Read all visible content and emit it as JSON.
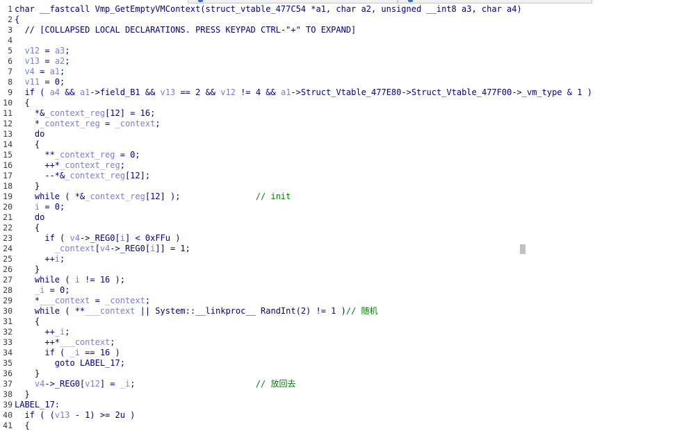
{
  "lines": [
    {
      "n": "1",
      "tokens": [
        {
          "t": "t",
          "s": "char __fastcall Vmp_GetEmptyVMContext(struct_vtable_477C54 *a1, char a2, unsigned __int8 a3, char a4)"
        }
      ]
    },
    {
      "n": "2",
      "tokens": [
        {
          "t": "t",
          "s": "{"
        }
      ]
    },
    {
      "n": "3",
      "tokens": [
        {
          "t": "t",
          "s": "  // [COLLAPSED LOCAL DECLARATIONS. PRESS KEYPAD CTRL-\"+\" TO EXPAND]"
        }
      ]
    },
    {
      "n": "4",
      "tokens": []
    },
    {
      "n": "5",
      "tokens": [
        {
          "t": "v",
          "s": "  v12"
        },
        {
          "t": "t",
          "s": " = "
        },
        {
          "t": "v",
          "s": "a3"
        },
        {
          "t": "t",
          "s": ";"
        }
      ]
    },
    {
      "n": "6",
      "tokens": [
        {
          "t": "v",
          "s": "  v13"
        },
        {
          "t": "t",
          "s": " = "
        },
        {
          "t": "v",
          "s": "a2"
        },
        {
          "t": "t",
          "s": ";"
        }
      ]
    },
    {
      "n": "7",
      "tokens": [
        {
          "t": "v",
          "s": "  v4"
        },
        {
          "t": "t",
          "s": " = "
        },
        {
          "t": "v",
          "s": "a1"
        },
        {
          "t": "t",
          "s": ";"
        }
      ]
    },
    {
      "n": "8",
      "tokens": [
        {
          "t": "v",
          "s": "  v11"
        },
        {
          "t": "t",
          "s": " = 0;"
        }
      ]
    },
    {
      "n": "9",
      "tokens": [
        {
          "t": "t",
          "s": "  if ( "
        },
        {
          "t": "v",
          "s": "a4"
        },
        {
          "t": "t",
          "s": " && "
        },
        {
          "t": "v",
          "s": "a1"
        },
        {
          "t": "t",
          "s": "->field_B1 && "
        },
        {
          "t": "v",
          "s": "v13"
        },
        {
          "t": "t",
          "s": " == 2 && "
        },
        {
          "t": "v",
          "s": "v12"
        },
        {
          "t": "t",
          "s": " != 4 && "
        },
        {
          "t": "v",
          "s": "a1"
        },
        {
          "t": "t",
          "s": "->Struct_Vtable_477E80->Struct_Vtable_477F00->_vm_type & 1 )"
        }
      ]
    },
    {
      "n": "10",
      "tokens": [
        {
          "t": "t",
          "s": "  {"
        }
      ]
    },
    {
      "n": "11",
      "tokens": [
        {
          "t": "t",
          "s": "    *&"
        },
        {
          "t": "v",
          "s": "_context_reg"
        },
        {
          "t": "t",
          "s": "[12] = 16;"
        }
      ]
    },
    {
      "n": "12",
      "tokens": [
        {
          "t": "t",
          "s": "    *"
        },
        {
          "t": "v",
          "s": "_context_reg"
        },
        {
          "t": "t",
          "s": " = "
        },
        {
          "t": "v",
          "s": "_context"
        },
        {
          "t": "t",
          "s": ";"
        }
      ]
    },
    {
      "n": "13",
      "tokens": [
        {
          "t": "t",
          "s": "    do"
        }
      ]
    },
    {
      "n": "14",
      "tokens": [
        {
          "t": "t",
          "s": "    {"
        }
      ]
    },
    {
      "n": "15",
      "tokens": [
        {
          "t": "t",
          "s": "      **"
        },
        {
          "t": "v",
          "s": "_context_reg"
        },
        {
          "t": "t",
          "s": " = 0;"
        }
      ]
    },
    {
      "n": "16",
      "tokens": [
        {
          "t": "t",
          "s": "      ++*"
        },
        {
          "t": "v",
          "s": "_context_reg"
        },
        {
          "t": "t",
          "s": ";"
        }
      ]
    },
    {
      "n": "17",
      "tokens": [
        {
          "t": "t",
          "s": "      --*&"
        },
        {
          "t": "v",
          "s": "_context_reg"
        },
        {
          "t": "t",
          "s": "[12];"
        }
      ]
    },
    {
      "n": "18",
      "tokens": [
        {
          "t": "t",
          "s": "    }"
        }
      ]
    },
    {
      "n": "19",
      "tokens": [
        {
          "t": "t",
          "s": "    while ( *&"
        },
        {
          "t": "v",
          "s": "_context_reg"
        },
        {
          "t": "t",
          "s": "[12] );               "
        },
        {
          "t": "c",
          "s": "// init"
        }
      ]
    },
    {
      "n": "20",
      "tokens": [
        {
          "t": "v",
          "s": "    i"
        },
        {
          "t": "t",
          "s": " = 0;"
        }
      ]
    },
    {
      "n": "21",
      "tokens": [
        {
          "t": "t",
          "s": "    do"
        }
      ]
    },
    {
      "n": "22",
      "tokens": [
        {
          "t": "t",
          "s": "    {"
        }
      ]
    },
    {
      "n": "23",
      "tokens": [
        {
          "t": "t",
          "s": "      if ( "
        },
        {
          "t": "v",
          "s": "v4"
        },
        {
          "t": "t",
          "s": "->_REG0["
        },
        {
          "t": "v",
          "s": "i"
        },
        {
          "t": "t",
          "s": "] < 0xFFu )"
        }
      ]
    },
    {
      "n": "24",
      "tokens": [
        {
          "t": "v",
          "s": "        _context"
        },
        {
          "t": "t",
          "s": "["
        },
        {
          "t": "v",
          "s": "v4"
        },
        {
          "t": "t",
          "s": "->_REG0["
        },
        {
          "t": "v",
          "s": "i"
        },
        {
          "t": "t",
          "s": "]] = 1;"
        }
      ]
    },
    {
      "n": "25",
      "tokens": [
        {
          "t": "t",
          "s": "      ++"
        },
        {
          "t": "v",
          "s": "i"
        },
        {
          "t": "t",
          "s": ";"
        }
      ]
    },
    {
      "n": "26",
      "tokens": [
        {
          "t": "t",
          "s": "    }"
        }
      ]
    },
    {
      "n": "27",
      "tokens": [
        {
          "t": "t",
          "s": "    while ( "
        },
        {
          "t": "v",
          "s": "i"
        },
        {
          "t": "t",
          "s": " != 16 );"
        }
      ]
    },
    {
      "n": "28",
      "tokens": [
        {
          "t": "v",
          "s": "    _i"
        },
        {
          "t": "t",
          "s": " = 0;"
        }
      ]
    },
    {
      "n": "29",
      "tokens": [
        {
          "t": "t",
          "s": "    *"
        },
        {
          "t": "v",
          "s": "___context"
        },
        {
          "t": "t",
          "s": " = "
        },
        {
          "t": "v",
          "s": "_context"
        },
        {
          "t": "t",
          "s": ";"
        }
      ]
    },
    {
      "n": "30",
      "tokens": [
        {
          "t": "t",
          "s": "    while ( **"
        },
        {
          "t": "v",
          "s": "___context"
        },
        {
          "t": "t",
          "s": " || System::__linkproc__ RandInt(2) != 1 )"
        },
        {
          "t": "c",
          "s": "// 随机"
        }
      ]
    },
    {
      "n": "31",
      "tokens": [
        {
          "t": "t",
          "s": "    {"
        }
      ]
    },
    {
      "n": "32",
      "tokens": [
        {
          "t": "t",
          "s": "      ++"
        },
        {
          "t": "v",
          "s": "_i"
        },
        {
          "t": "t",
          "s": ";"
        }
      ]
    },
    {
      "n": "33",
      "tokens": [
        {
          "t": "t",
          "s": "      ++*"
        },
        {
          "t": "v",
          "s": "___context"
        },
        {
          "t": "t",
          "s": ";"
        }
      ]
    },
    {
      "n": "34",
      "tokens": [
        {
          "t": "t",
          "s": "      if ( "
        },
        {
          "t": "v",
          "s": "_i"
        },
        {
          "t": "t",
          "s": " == 16 )"
        }
      ]
    },
    {
      "n": "35",
      "tokens": [
        {
          "t": "t",
          "s": "        goto LABEL_17;"
        }
      ]
    },
    {
      "n": "36",
      "tokens": [
        {
          "t": "t",
          "s": "    }"
        }
      ]
    },
    {
      "n": "37",
      "tokens": [
        {
          "t": "v",
          "s": "    v4"
        },
        {
          "t": "t",
          "s": "->_REG0["
        },
        {
          "t": "v",
          "s": "v12"
        },
        {
          "t": "t",
          "s": "] = "
        },
        {
          "t": "v",
          "s": "_i"
        },
        {
          "t": "t",
          "s": ";                        "
        },
        {
          "t": "c",
          "s": "// 放回去"
        }
      ]
    },
    {
      "n": "38",
      "tokens": [
        {
          "t": "t",
          "s": "  }"
        }
      ]
    },
    {
      "n": "39",
      "tokens": [
        {
          "t": "t",
          "s": "LABEL_17:"
        }
      ]
    },
    {
      "n": "40",
      "tokens": [
        {
          "t": "t",
          "s": "  if ( ("
        },
        {
          "t": "v",
          "s": "v13"
        },
        {
          "t": "t",
          "s": " - 1) >= 2u )"
        }
      ]
    },
    {
      "n": "41",
      "tokens": [
        {
          "t": "t",
          "s": "  {"
        }
      ]
    }
  ]
}
